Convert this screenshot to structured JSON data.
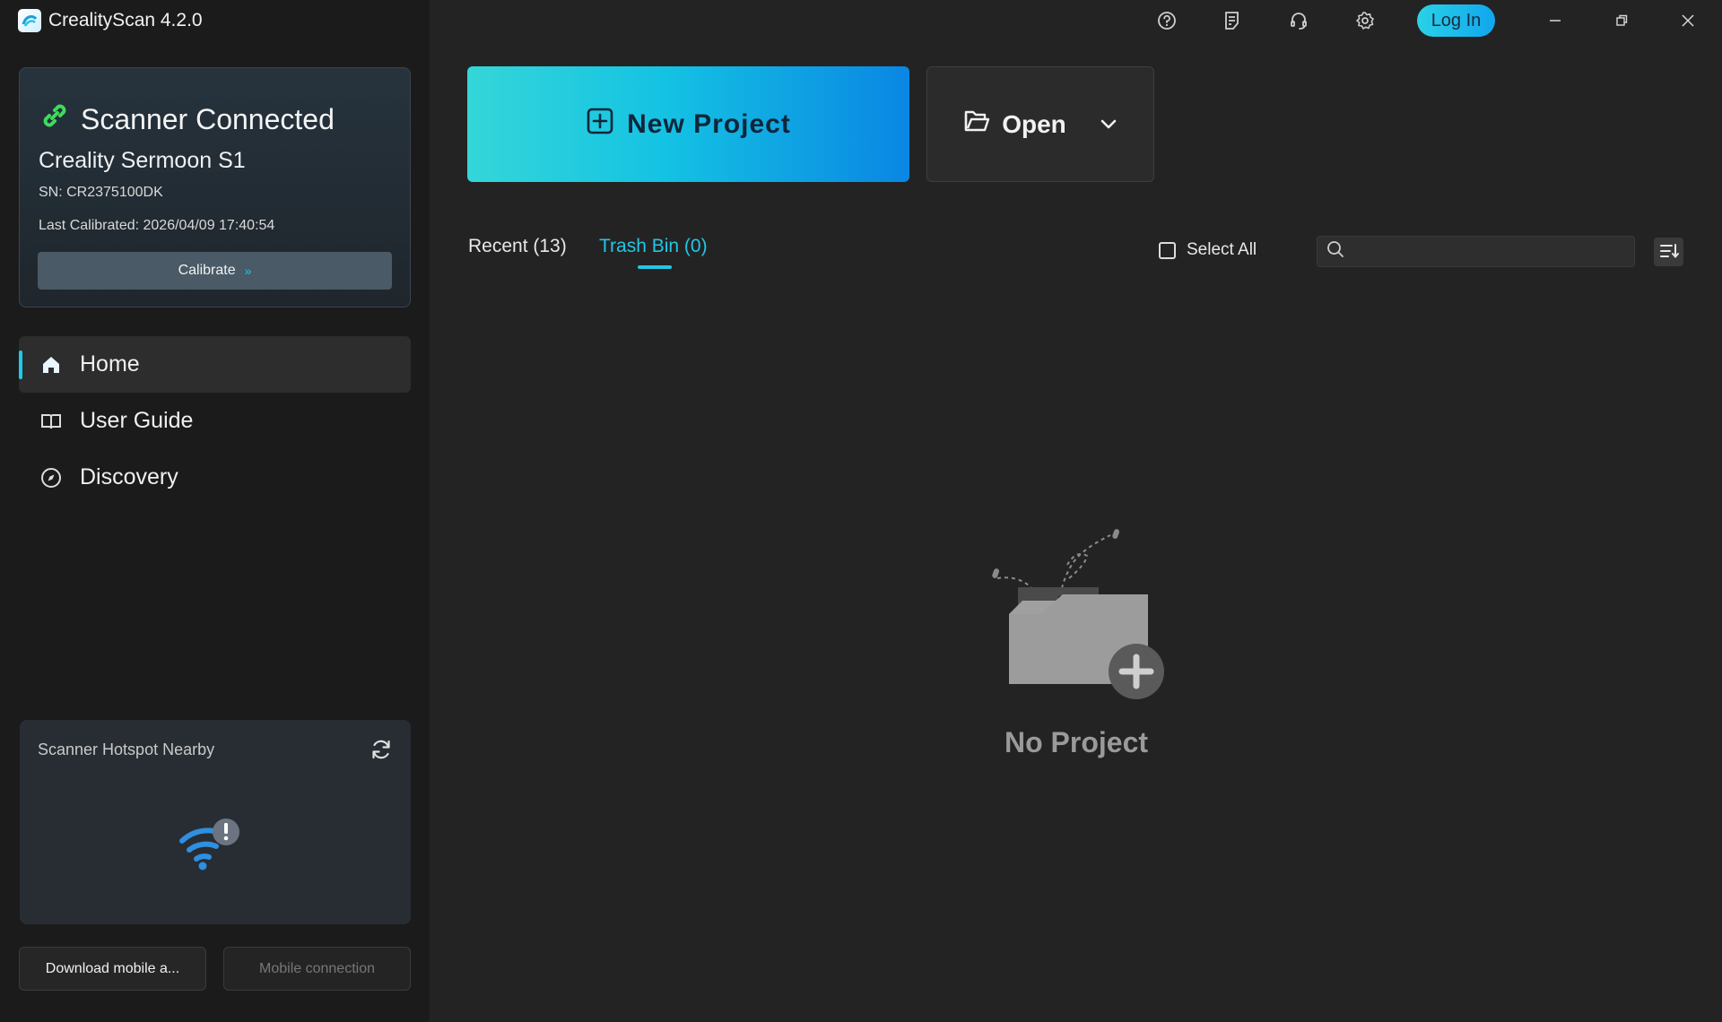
{
  "app": {
    "title": "CrealityScan 4.2.0"
  },
  "scanner": {
    "status": "Scanner Connected",
    "model": "Creality Sermoon S1",
    "sn": "SN: CR2375100DK",
    "last_calibrated": "Last Calibrated: 2026/04/09 17:40:54",
    "calibrate_label": "Calibrate",
    "calibrate_chevron": "»"
  },
  "nav": {
    "items": [
      {
        "label": "Home",
        "icon": "home-icon",
        "active": true
      },
      {
        "label": "User Guide",
        "icon": "book-icon",
        "active": false
      },
      {
        "label": "Discovery",
        "icon": "compass-icon",
        "active": false
      }
    ]
  },
  "hotspot": {
    "title": "Scanner Hotspot Nearby"
  },
  "bottom": {
    "download_label": "Download mobile a...",
    "mobile_label": "Mobile connection"
  },
  "topbar": {
    "login_label": "Log In"
  },
  "main": {
    "new_project_label": "New Project",
    "open_label": "Open",
    "tabs": [
      {
        "label": "Recent (13)",
        "active": false
      },
      {
        "label": "Trash Bin (0)",
        "active": true
      }
    ],
    "select_all_label": "Select All",
    "search_placeholder": "",
    "empty_text": "No Project"
  },
  "colors": {
    "accent": "#23c6e6",
    "connected_green": "#3ddc5a",
    "sidebar_bg": "#1b1b1b",
    "main_bg": "#232323"
  }
}
